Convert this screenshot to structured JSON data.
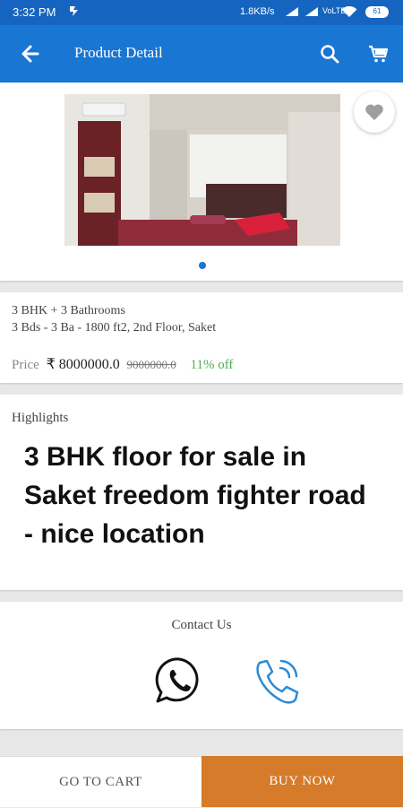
{
  "status_bar": {
    "time": "3:32 PM",
    "network_speed": "1.8KB/s",
    "network_type": "VoLTE",
    "battery": "61"
  },
  "app_bar": {
    "title": "Product Detail",
    "back_icon": "arrow-left-icon",
    "search_icon": "search-icon",
    "cart_icon": "cart-icon"
  },
  "product": {
    "configuration": "3 BHK + 3 Bathrooms",
    "details": "3 Bds - 3 Ba - 1800 ft2, 2nd Floor, Saket",
    "price_label": "Price",
    "currency": "₹",
    "price": "8000000.0",
    "mrp": "9000000.0",
    "discount": "11% off",
    "image_count": 1,
    "current_image": 1
  },
  "highlights": {
    "label": "Highlights",
    "headline": "3 BHK floor for sale in Saket freedom fighter road - nice location"
  },
  "contact": {
    "label": "Contact Us",
    "whatsapp_icon": "whatsapp-icon",
    "phone_icon": "phone-icon"
  },
  "actions": {
    "go_to_cart": "GO TO CART",
    "buy_now": "BUY NOW"
  },
  "colors": {
    "primary": "#1976d2",
    "status_bar": "#1565c0",
    "buy_now": "#d57b2a",
    "discount": "#4caf50",
    "phone_icon": "#2a8bd6"
  }
}
